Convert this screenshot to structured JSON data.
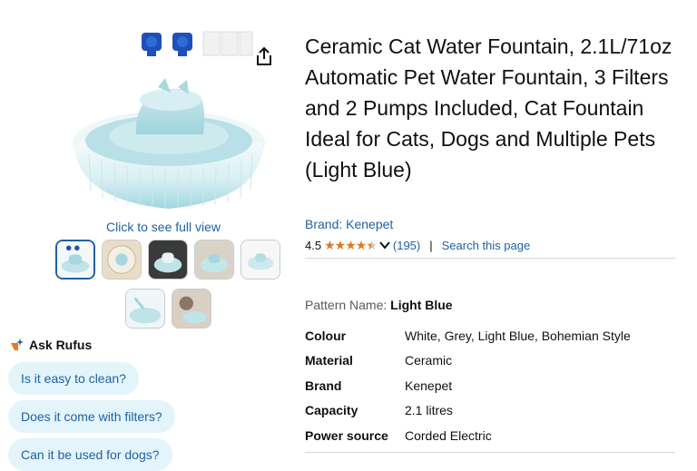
{
  "gallery": {
    "main_image_alt": "Ceramic cat water fountain in light blue",
    "full_view_link": "Click to see full view",
    "thumbnails": [
      {
        "name": "thumb-1",
        "selected": true
      },
      {
        "name": "thumb-2",
        "selected": false
      },
      {
        "name": "thumb-3",
        "selected": false
      },
      {
        "name": "thumb-4",
        "selected": false
      },
      {
        "name": "thumb-5",
        "selected": false
      },
      {
        "name": "thumb-6",
        "selected": false
      },
      {
        "name": "thumb-7",
        "selected": false
      }
    ],
    "share_icon": "share-icon"
  },
  "rufus": {
    "title": "Ask Rufus",
    "questions": [
      "Is it easy to clean?",
      "Does it come with filters?",
      "Can it be used for dogs?"
    ]
  },
  "product": {
    "title": "Ceramic Cat Water Fountain, 2.1L/71oz Automatic Pet Water Fountain, 3 Filters and 2 Pumps Included, Cat Fountain Ideal for Cats, Dogs and Multiple Pets (Light Blue)",
    "brand_link": "Brand: Kenepet",
    "rating": "4.5",
    "stars_filled": 4.5,
    "ratings_count": "(195)",
    "search_page": "Search this page",
    "pattern_label": "Pattern Name: ",
    "pattern_value": "Light Blue",
    "specs": [
      {
        "key": "Colour",
        "value": "White, Grey, Light Blue, Bohemian Style"
      },
      {
        "key": "Material",
        "value": "Ceramic"
      },
      {
        "key": "Brand",
        "value": "Kenepet"
      },
      {
        "key": "Capacity",
        "value": "2.1 litres"
      },
      {
        "key": "Power source",
        "value": "Corded Electric"
      }
    ]
  },
  "colors": {
    "link": "#2162a1",
    "star": "#de7921",
    "chip_bg": "#e3f4fb",
    "rufus_accent": "#f97316"
  }
}
